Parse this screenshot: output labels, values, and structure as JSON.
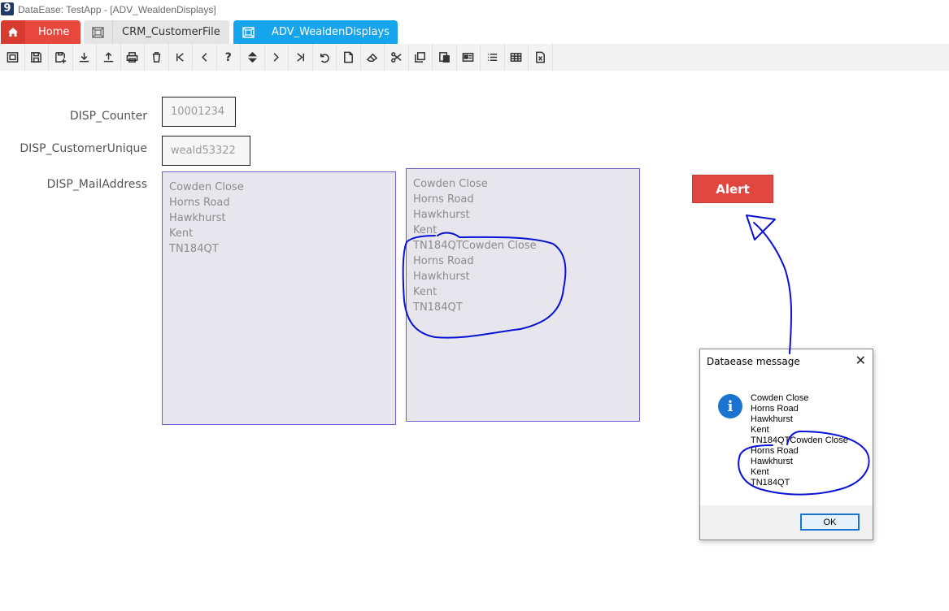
{
  "window": {
    "title": "DataEase: TestApp - [ADV_WealdenDisplays]"
  },
  "tabs": [
    {
      "label": "Home",
      "icon": "home-icon"
    },
    {
      "label": "CRM_CustomerFile",
      "icon": "form-icon"
    },
    {
      "label": "ADV_WealdenDisplays",
      "icon": "form-icon"
    }
  ],
  "toolbar": {
    "icons": [
      "form-view-icon",
      "save-icon",
      "save-add-icon",
      "download-icon",
      "upload-icon",
      "print-icon",
      "delete-icon",
      "first-record-icon",
      "previous-record-icon",
      "help-icon",
      "sort-icon",
      "next-record-icon",
      "last-record-icon",
      "undo-icon",
      "new-document-icon",
      "eraser-icon",
      "cut-icon",
      "copy-icon",
      "paste-icon",
      "card-view-icon",
      "list-view-icon",
      "table-view-icon",
      "excel-export-icon"
    ]
  },
  "form": {
    "counter": {
      "label": "DISP_Counter",
      "value": "10001234"
    },
    "customer_unique": {
      "label": "DISP_CustomerUnique",
      "value": "weald53322"
    },
    "mail_address": {
      "label": "DISP_MailAddress",
      "lines": [
        "Cowden Close",
        "Horns Road",
        "Hawkhurst",
        "Kent",
        "TN184QT"
      ]
    },
    "mail_address_2": {
      "lines": [
        "Cowden Close",
        "Horns Road",
        "Hawkhurst",
        "Kent",
        "TN184QTCowden Close",
        "Horns Road",
        "Hawkhurst",
        "Kent",
        "TN184QT"
      ]
    },
    "alert_button": "Alert"
  },
  "dialog": {
    "title": "Dataease message",
    "close": "✕",
    "icon": "info-icon",
    "icon_glyph": "i",
    "lines": [
      "Cowden Close",
      "Horns Road",
      "Hawkhurst",
      "Kent",
      "TN184QTCowden Close",
      "Horns Road",
      "Hawkhurst",
      "Kent",
      "TN184QT"
    ],
    "ok_label": "OK"
  },
  "colors": {
    "home_tab": "#e8473d",
    "active_tab": "#16a4ec",
    "alert": "#e14640",
    "annotation": "#0a12d6"
  }
}
